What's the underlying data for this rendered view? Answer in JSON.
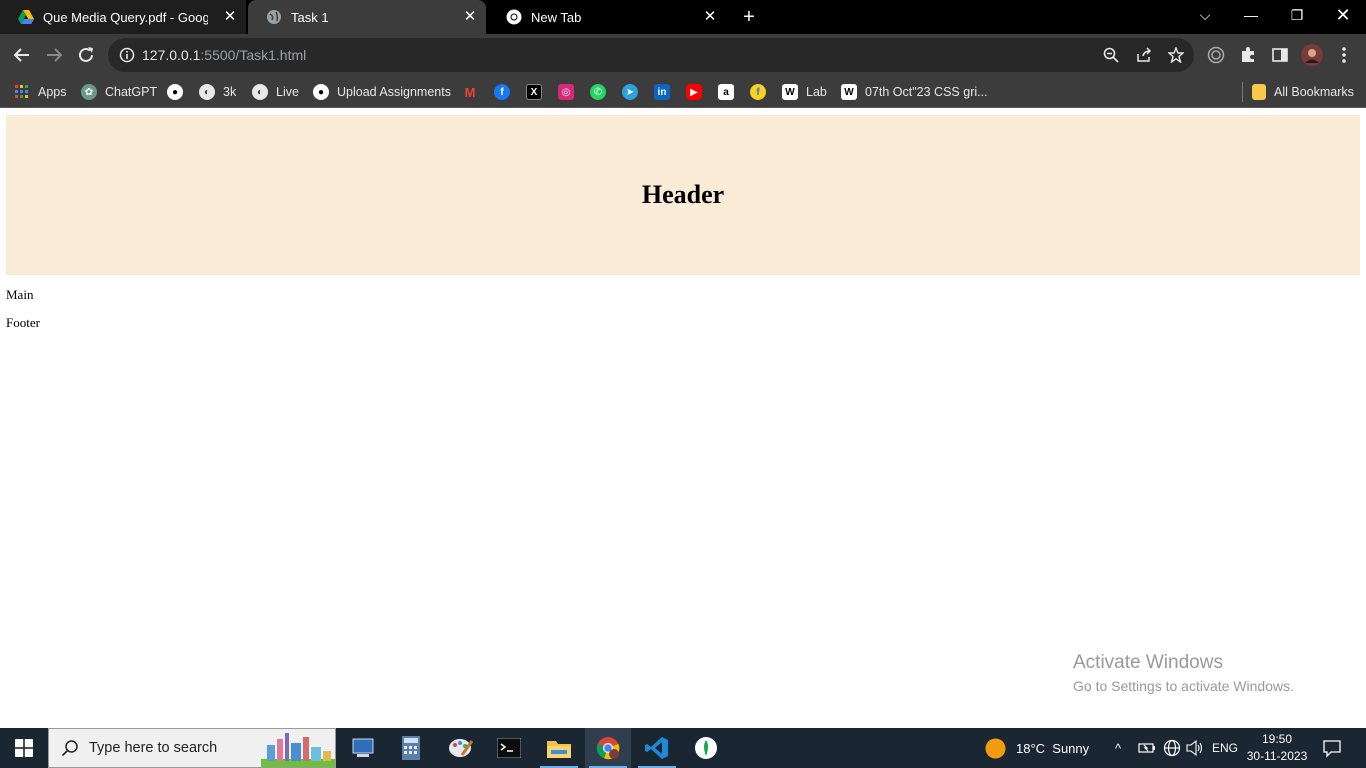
{
  "browser": {
    "tabs": [
      {
        "title": "Que Media Query.pdf - Google Drive",
        "favicon": "google-drive-icon"
      },
      {
        "title": "Task 1",
        "favicon": "globe-icon"
      },
      {
        "title": "New Tab",
        "favicon": "chrome-icon"
      }
    ],
    "address": {
      "host": "127.0.0.1",
      "rest": ":5500/Task1.html"
    },
    "bookmarks": [
      {
        "label": "Apps",
        "icon": "apps-grid-icon"
      },
      {
        "label": "ChatGPT",
        "icon": "chatgpt-icon"
      },
      {
        "label": "",
        "icon": "github-icon"
      },
      {
        "label": "3k",
        "icon": "globe-icon"
      },
      {
        "label": "Live",
        "icon": "globe-icon"
      },
      {
        "label": "Upload Assignments",
        "icon": "github-icon"
      },
      {
        "label": "",
        "icon": "gmail-icon"
      },
      {
        "label": "",
        "icon": "facebook-icon"
      },
      {
        "label": "",
        "icon": "x-icon"
      },
      {
        "label": "",
        "icon": "instagram-icon"
      },
      {
        "label": "",
        "icon": "whatsapp-icon"
      },
      {
        "label": "",
        "icon": "telegram-icon"
      },
      {
        "label": "",
        "icon": "linkedin-icon"
      },
      {
        "label": "",
        "icon": "youtube-icon"
      },
      {
        "label": "",
        "icon": "amazon-icon"
      },
      {
        "label": "",
        "icon": "flipkart-icon"
      },
      {
        "label": "Lab",
        "icon": "page-icon"
      },
      {
        "label": "07th Oct\"23 CSS gri...",
        "icon": "page-icon"
      }
    ],
    "all_bookmarks": "All Bookmarks"
  },
  "page": {
    "header": "Header",
    "main": "Main",
    "footer": "Footer"
  },
  "watermark": {
    "line1": "Activate Windows",
    "line2": "Go to Settings to activate Windows."
  },
  "taskbar": {
    "search_placeholder": "Type here to search",
    "weather": "18°C  Sunny",
    "language": "ENG",
    "time": "19:50",
    "date": "30-11-2023"
  },
  "colors": {
    "header_bg": "#faebd7",
    "tabstrip_bg": "#000000",
    "toolbar_bg": "#3c3c3c",
    "taskbar_bg": "#1b2633"
  }
}
